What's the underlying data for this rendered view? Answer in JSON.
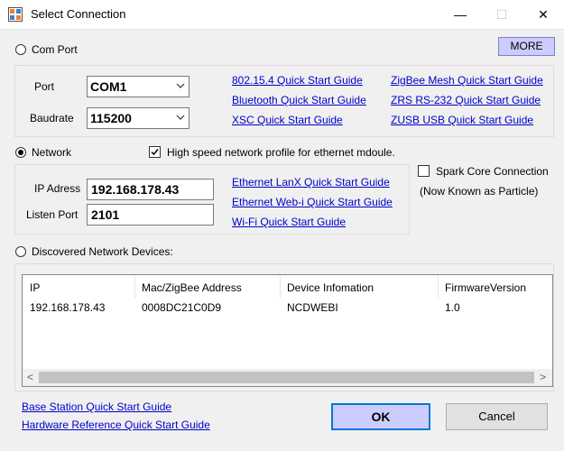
{
  "window": {
    "title": "Select Connection",
    "minimize_glyph": "—",
    "maximize_glyph": "☐",
    "close_glyph": "✕"
  },
  "com_port": {
    "radio_label": "Com Port",
    "selected": false,
    "more_button": "MORE",
    "port_label": "Port",
    "port_value": "COM1",
    "baudrate_label": "Baudrate",
    "baudrate_value": "115200",
    "links": [
      "802.15.4 Quick Start Guide",
      "ZigBee Mesh Quick Start Guide",
      "Bluetooth Quick Start Guide",
      "ZRS RS-232 Quick Start Guide",
      "XSC Quick Start Guide",
      "ZUSB USB Quick Start Guide"
    ]
  },
  "network": {
    "radio_label": "Network",
    "selected": true,
    "high_speed_label": "High speed network profile for ethernet mdoule.",
    "high_speed_checked": true,
    "ip_label": "IP Adress",
    "ip_value": "192.168.178.43",
    "port_label": "Listen Port",
    "port_value": "2101",
    "links": [
      "Ethernet LanX Quick Start Guide",
      "Ethernet Web-i Quick Start Guide",
      "Wi-Fi Quick Start Guide"
    ],
    "spark_label": "Spark Core Connection",
    "spark_checked": false,
    "spark_note": "(Now Known as Particle)"
  },
  "discovered": {
    "radio_label": "Discovered Network Devices:",
    "selected": false,
    "columns": [
      "IP",
      "Mac/ZigBee Address",
      "Device Infomation",
      "FirmwareVersion"
    ],
    "rows": [
      [
        "192.168.178.43",
        "0008DC21C0D9",
        "NCDWEBI",
        "1.0"
      ]
    ],
    "scroll_left": "<",
    "scroll_right": ">"
  },
  "footer": {
    "links": [
      "Base Station Quick Start Guide",
      "Hardware Reference Quick Start Guide"
    ],
    "ok_label": "OK",
    "cancel_label": "Cancel"
  },
  "colors": {
    "link": "#0000cc",
    "ok_bg": "#ccccff",
    "ok_border": "#0078d7"
  },
  "icons": {
    "app": "app-icon",
    "combo_arrow": "chevron-down-icon",
    "checkmark": "check-icon"
  }
}
